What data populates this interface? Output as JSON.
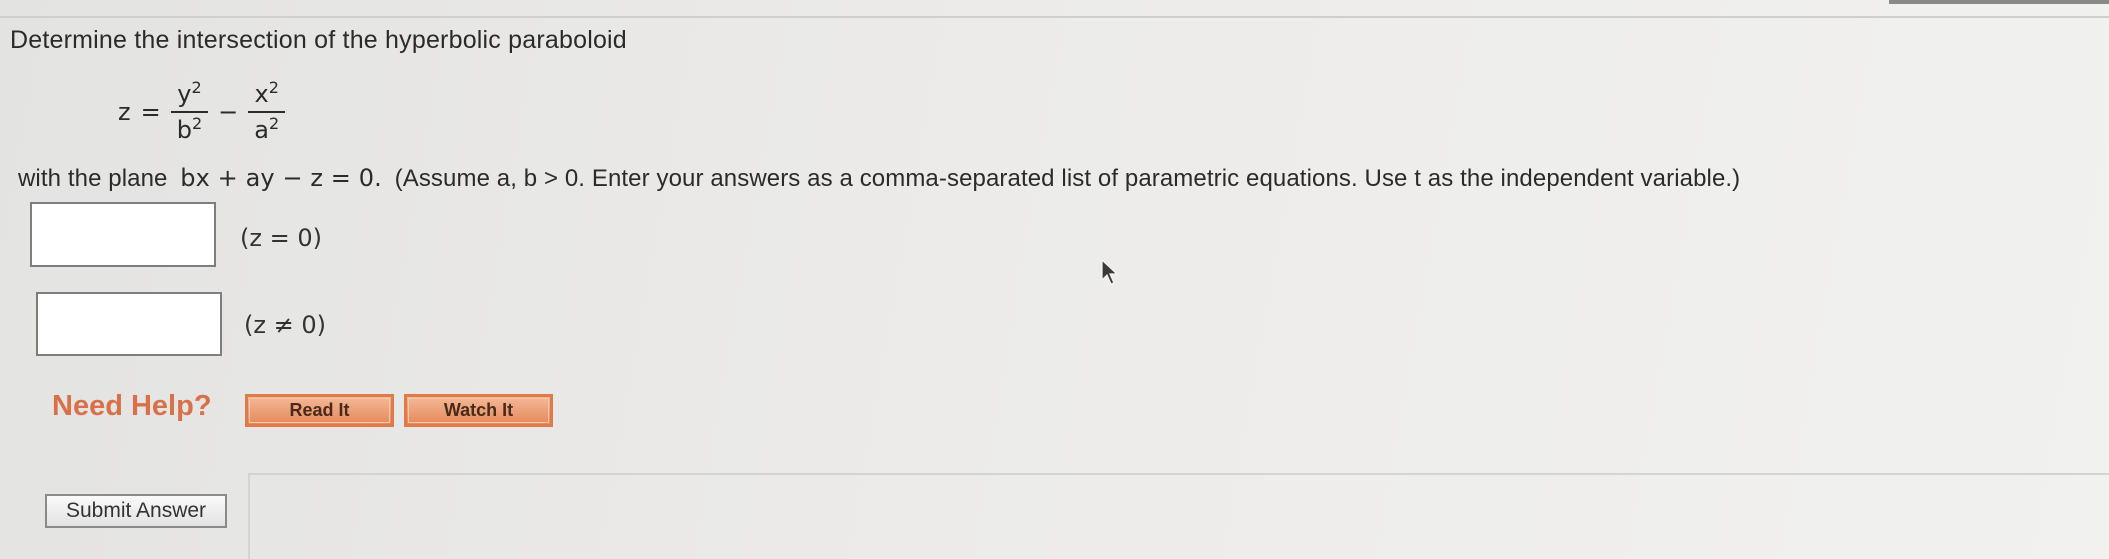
{
  "question": {
    "intro": "Determine the intersection of the hyperbolic paraboloid",
    "equation": {
      "lhs": "z",
      "equals": "=",
      "term1_num": "y",
      "term1_num_exp": "2",
      "term1_den": "b",
      "term1_den_exp": "2",
      "minus": "−",
      "term2_num": "x",
      "term2_num_exp": "2",
      "term2_den": "a",
      "term2_den_exp": "2"
    },
    "plane_prefix": "with the plane",
    "plane_equation": "bx + ay − z = 0.",
    "instructions": "(Assume a, b > 0. Enter your answers as a comma-separated list of parametric equations. Use t as the independent variable.)"
  },
  "answers": [
    {
      "value": "",
      "condition": "(z = 0)"
    },
    {
      "value": "",
      "condition": "(z ≠ 0)"
    }
  ],
  "help": {
    "label": "Need Help?",
    "read_it": "Read It",
    "watch_it": "Watch It"
  },
  "submit": {
    "label": "Submit Answer"
  },
  "colors": {
    "help_text": "#d9704a",
    "help_button": "#e6895a"
  },
  "icons": {
    "cursor": "mouse-pointer-icon"
  }
}
